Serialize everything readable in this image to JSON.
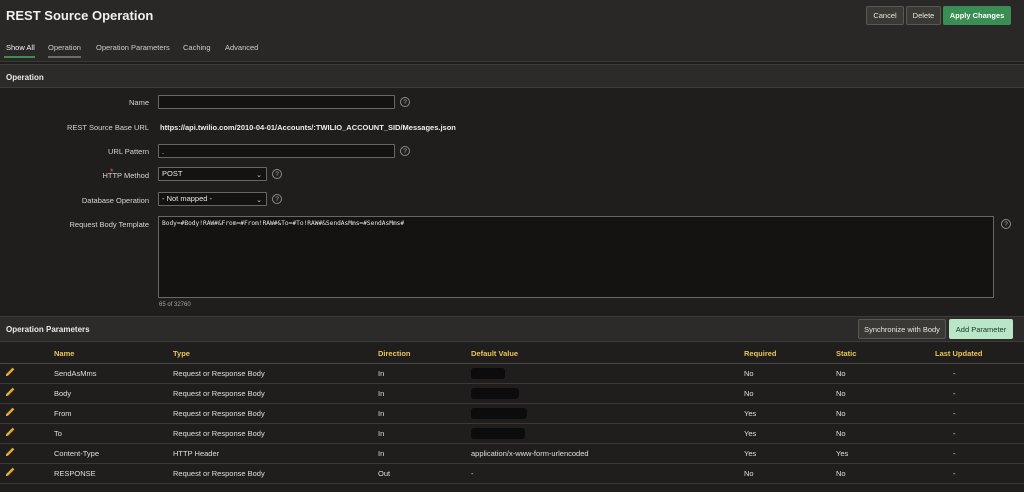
{
  "header": {
    "title": "REST Source Operation",
    "cancel_label": "Cancel",
    "delete_label": "Delete",
    "apply_label": "Apply Changes"
  },
  "tabs": [
    {
      "label": "Show All",
      "active": true
    },
    {
      "label": "Operation"
    },
    {
      "label": "Operation Parameters"
    },
    {
      "label": "Caching"
    },
    {
      "label": "Advanced"
    }
  ],
  "operation": {
    "section_title": "Operation",
    "name_label": "Name",
    "name_value": "",
    "base_url_label": "REST Source Base URL",
    "base_url_value": "https://api.twilio.com/2010-04-01/Accounts/:TWILIO_ACCOUNT_SID/Messages.json",
    "url_pattern_label": "URL Pattern",
    "url_pattern_value": ".",
    "http_method_label": "HTTP Method",
    "http_method_value": "POST",
    "db_operation_label": "Database Operation",
    "db_operation_value": "- Not mapped -",
    "body_template_label": "Request Body Template",
    "body_template_value": "Body=#Body!RAW#&From=#From!RAW#&To=#To!RAW#&SendAsMms=#SendAsMms#",
    "body_counter": "65 of 32760",
    "required_marker": "*",
    "help_glyph": "?"
  },
  "params": {
    "section_title": "Operation Parameters",
    "sync_label": "Synchronize with Body",
    "add_label": "Add Parameter",
    "columns": [
      "Name",
      "Type",
      "Direction",
      "Default Value",
      "Required",
      "Static",
      "Last Updated"
    ],
    "rows": [
      {
        "name": "SendAsMms",
        "type": "Request or Response Body",
        "direction": "In",
        "default": "",
        "required": "No",
        "static": "No",
        "updated": "-"
      },
      {
        "name": "Body",
        "type": "Request or Response Body",
        "direction": "In",
        "default": "",
        "required": "No",
        "static": "No",
        "updated": "-"
      },
      {
        "name": "From",
        "type": "Request or Response Body",
        "direction": "In",
        "default": "",
        "required": "Yes",
        "static": "No",
        "updated": "-"
      },
      {
        "name": "To",
        "type": "Request or Response Body",
        "direction": "In",
        "default": "",
        "required": "Yes",
        "static": "No",
        "updated": "-"
      },
      {
        "name": "Content-Type",
        "type": "HTTP Header",
        "direction": "In",
        "default": "application/x-www-form-urlencoded",
        "required": "Yes",
        "static": "Yes",
        "updated": "-"
      },
      {
        "name": "RESPONSE",
        "type": "Request or Response Body",
        "direction": "Out",
        "default": "-",
        "required": "No",
        "static": "No",
        "updated": "-"
      }
    ]
  },
  "colors": {
    "accent": "#3a8e53",
    "header_text": "#e9c45a",
    "pencil": "#e3a92c"
  },
  "icons": {
    "edit": "pencil-icon",
    "help": "help-icon",
    "dropdown": "chevron-down-icon"
  }
}
